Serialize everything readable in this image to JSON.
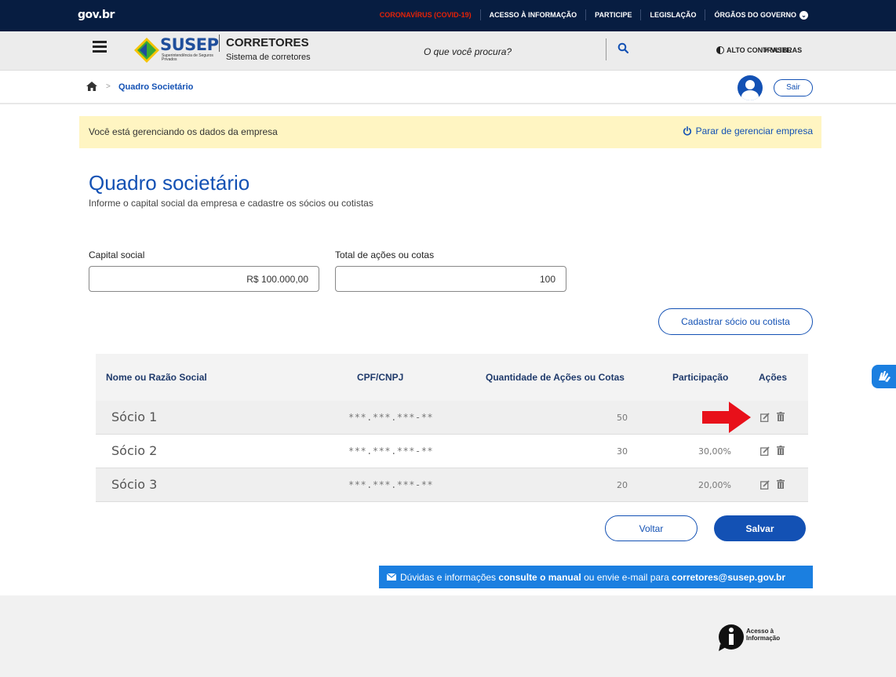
{
  "govbar": {
    "logo": "gov.br",
    "links": [
      "CORONAVÍRUS (COVID-19)",
      "ACESSO À INFORMAÇÃO",
      "PARTICIPE",
      "LEGISLAÇÃO",
      "ÓRGÃOS DO GOVERNO"
    ]
  },
  "header": {
    "brand": "SUSEP",
    "brand_sub": "Superintendência de Seguros Privados",
    "title": "CORRETORES",
    "subtitle": "Sistema de corretores",
    "search_placeholder": "O que você procura?",
    "contrast_label": "ALTO CONTRASTE",
    "vlibras_label": "VLIBRAS"
  },
  "breadcrumb": {
    "current": "Quadro Societário",
    "separator": ">",
    "logout_label": "Sair"
  },
  "notice": {
    "text": "Você está gerenciando os dados da empresa",
    "action": "Parar de gerenciar empresa"
  },
  "page": {
    "title": "Quadro societário",
    "subtitle": "Informe o capital social da empresa e cadastre os sócios ou cotistas"
  },
  "form": {
    "capital_label": "Capital social",
    "capital_value": "R$ 100.000,00",
    "total_label": "Total de ações ou cotas",
    "total_value": "100",
    "add_button": "Cadastrar sócio ou cotista"
  },
  "table": {
    "headers": [
      "Nome ou Razão Social",
      "CPF/CNPJ",
      "Quantidade de Ações ou Cotas",
      "Participação",
      "Ações"
    ],
    "rows": [
      {
        "name": "Sócio 1",
        "cpf": "***.***.***-**",
        "qty": "50",
        "pct": ""
      },
      {
        "name": "Sócio 2",
        "cpf": "***.***.***-**",
        "qty": "30",
        "pct": "30,00%"
      },
      {
        "name": "Sócio 3",
        "cpf": "***.***.***-**",
        "qty": "20",
        "pct": "20,00%"
      }
    ]
  },
  "buttons": {
    "back": "Voltar",
    "save": "Salvar"
  },
  "help": {
    "text1": "Dúvidas e informações ",
    "link1": "consulte o manual",
    "text2": " ou envie e-mail para ",
    "email": "corretores@susep.gov.br"
  },
  "footer": {
    "info_label": "Acesso à Informação"
  },
  "colors": {
    "primary": "#1351b4",
    "govbar": "#071d41",
    "notice_bg": "#fff5c2",
    "annotation_arrow": "#e8101a"
  }
}
